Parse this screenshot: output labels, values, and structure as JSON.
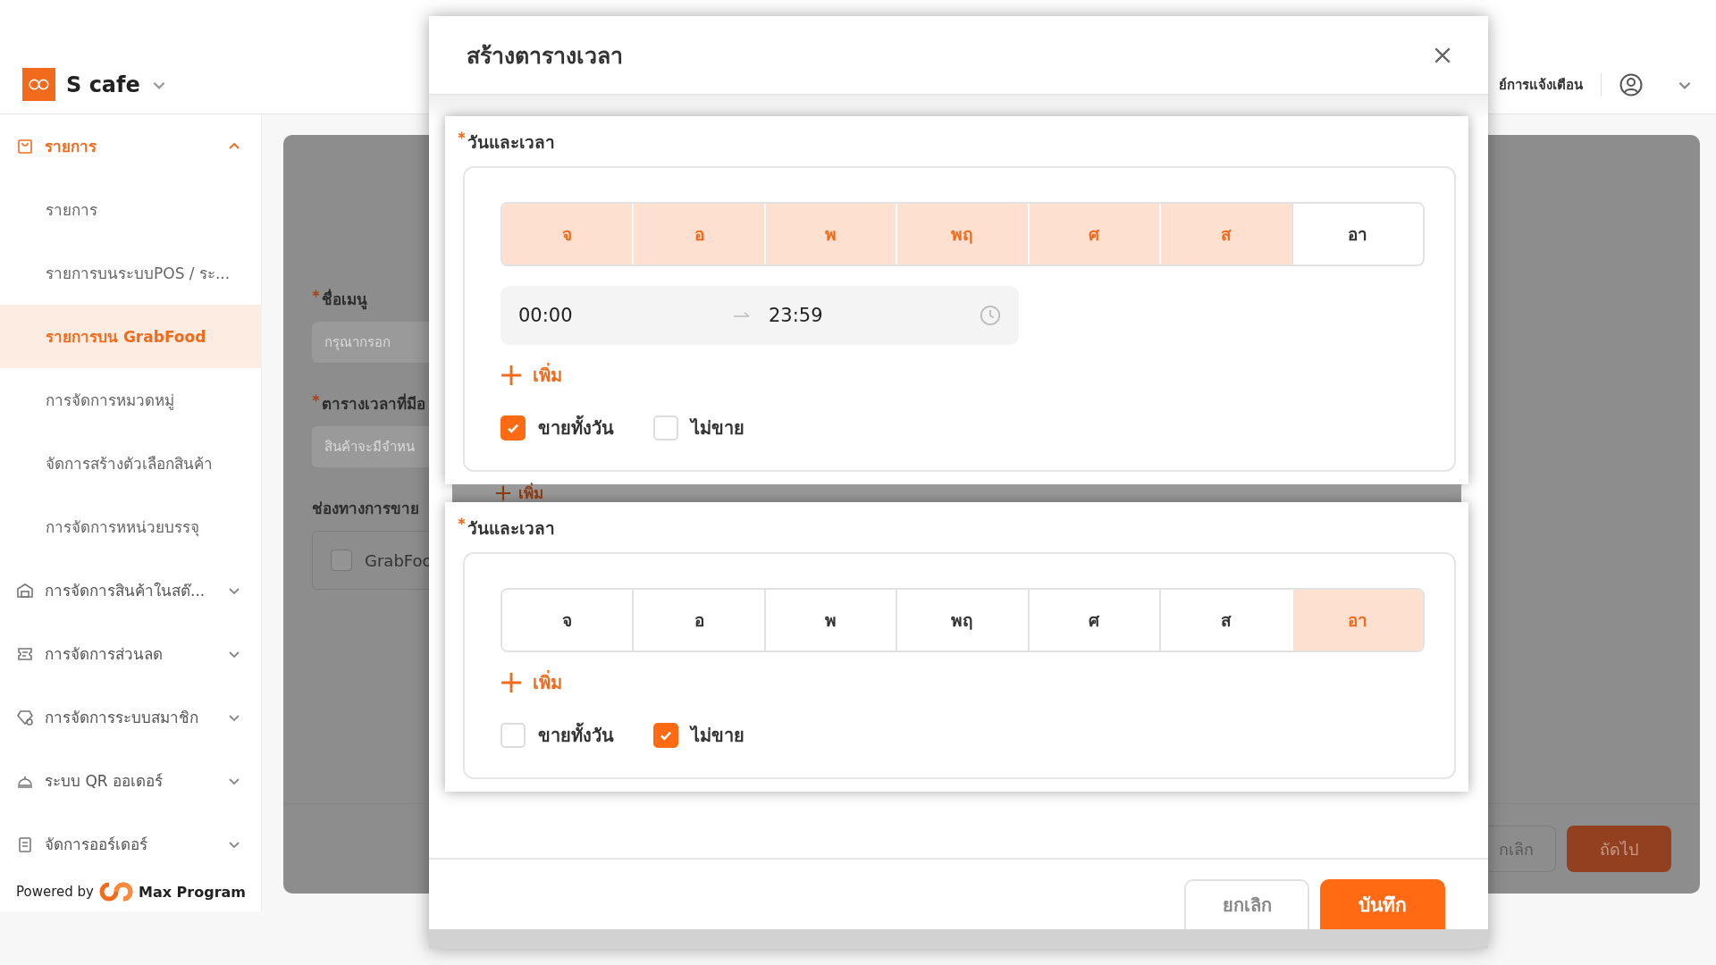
{
  "header": {
    "store_name": "S cafe",
    "notification_text": "ย์การแจ้งเตือน"
  },
  "sidebar": {
    "groups": [
      {
        "label": "รายการ",
        "active": true,
        "expanded": true,
        "children": [
          {
            "label": "รายการ",
            "selected": false
          },
          {
            "label": "รายการบนระบบPOS / ระ...",
            "selected": false
          },
          {
            "label": "รายการบน GrabFood",
            "selected": true
          },
          {
            "label": "การจัดการหมวดหมู่",
            "selected": false
          },
          {
            "label": "จัดการสร้างตัวเลือกสินค้า",
            "selected": false
          },
          {
            "label": "การจัดการหหน่วยบรรจุ",
            "selected": false
          }
        ]
      },
      {
        "label": "การจัดการสินค้าในสต๊...",
        "active": false,
        "expanded": false
      },
      {
        "label": "การจัดการส่วนลด",
        "active": false,
        "expanded": false
      },
      {
        "label": "การจัดการระบบสมาชิก",
        "active": false,
        "expanded": false
      },
      {
        "label": "ระบบ QR ออเดอร์",
        "active": false,
        "expanded": false
      },
      {
        "label": "จัดการออร์เดอร์",
        "active": false,
        "expanded": false
      }
    ],
    "powered_by": "Powered by",
    "brand": "Max Program"
  },
  "form": {
    "fields": [
      {
        "label": "ชื่อเมนู",
        "required": true,
        "placeholder": "กรุณากรอก"
      },
      {
        "label": "ตารางเวลาที่มีอ",
        "required": true,
        "placeholder": "สินค้าจะมีจำหน"
      }
    ],
    "channels_label": "ช่องทางการขาย",
    "channels": [
      {
        "label": "GrabFoo",
        "checked": false
      }
    ],
    "buttons": {
      "cancel": "กเลิก",
      "next": "ถัดไป"
    }
  },
  "dialog": {
    "title": "สร้างตารางเวลา",
    "schedules": [
      {
        "label": "วันและเวลา",
        "required": true,
        "days": [
          {
            "label": "จ",
            "selected": true
          },
          {
            "label": "อ",
            "selected": true
          },
          {
            "label": "พ",
            "selected": true
          },
          {
            "label": "พฤ",
            "selected": true
          },
          {
            "label": "ศ",
            "selected": true
          },
          {
            "label": "ส",
            "selected": true
          },
          {
            "label": "อา",
            "selected": false
          }
        ],
        "time_ranges": [
          {
            "start": "00:00",
            "end": "23:59"
          }
        ],
        "add_label": "เพิ่ม",
        "options": [
          {
            "label": "ขายทั้งวัน",
            "checked": true
          },
          {
            "label": "ไม่ขาย",
            "checked": false
          }
        ]
      },
      {
        "label": "วันและเวลา",
        "required": true,
        "days": [
          {
            "label": "จ",
            "selected": false
          },
          {
            "label": "อ",
            "selected": false
          },
          {
            "label": "พ",
            "selected": false
          },
          {
            "label": "พฤ",
            "selected": false
          },
          {
            "label": "ศ",
            "selected": false
          },
          {
            "label": "ส",
            "selected": false
          },
          {
            "label": "อา",
            "selected": true
          }
        ],
        "add_label": "เพิ่ม",
        "options": [
          {
            "label": "ขายทั้งวัน",
            "checked": false
          },
          {
            "label": "ไม่ขาย",
            "checked": true
          }
        ]
      }
    ],
    "hidden_add_label": "เพิ่ม",
    "buttons": {
      "cancel": "ยกเลิก",
      "save": "บันทึก"
    }
  }
}
